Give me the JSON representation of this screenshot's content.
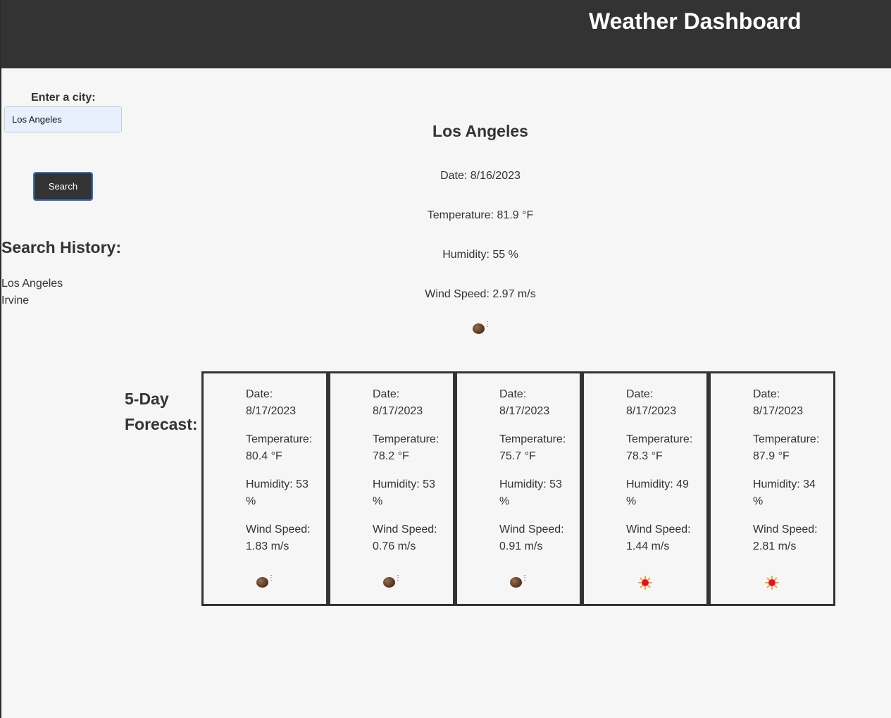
{
  "header": {
    "title": "Weather Dashboard"
  },
  "search": {
    "label": "Enter a city:",
    "value": "Los Angeles",
    "button_label": "Search"
  },
  "history": {
    "title": "Search History:",
    "items": [
      "Los Angeles",
      "Irvine"
    ]
  },
  "current": {
    "city": "Los Angeles",
    "date": "Date: 8/16/2023",
    "temperature": "Temperature: 81.9 °F",
    "humidity": "Humidity: 55 %",
    "wind": "Wind Speed: 2.97 m/s",
    "icon": "new-moon-face-icon"
  },
  "forecast": {
    "title_line1": "5-Day",
    "title_line2": "Forecast:",
    "days": [
      {
        "date_label": "Date:",
        "date": "8/17/2023",
        "temp_label": "Temperature:",
        "temp": "80.4 °F",
        "hum_label": "Humidity: 53",
        "hum_unit": "%",
        "wind_label": "Wind Speed:",
        "wind": "1.83 m/s",
        "icon": "new-moon-face-icon"
      },
      {
        "date_label": "Date:",
        "date": "8/17/2023",
        "temp_label": "Temperature:",
        "temp": "78.2 °F",
        "hum_label": "Humidity: 53",
        "hum_unit": "%",
        "wind_label": "Wind Speed:",
        "wind": "0.76 m/s",
        "icon": "new-moon-face-icon"
      },
      {
        "date_label": "Date:",
        "date": "8/17/2023",
        "temp_label": "Temperature:",
        "temp": "75.7 °F",
        "hum_label": "Humidity: 53",
        "hum_unit": "%",
        "wind_label": "Wind Speed:",
        "wind": "0.91 m/s",
        "icon": "new-moon-face-icon"
      },
      {
        "date_label": "Date:",
        "date": "8/17/2023",
        "temp_label": "Temperature:",
        "temp": "78.3 °F",
        "hum_label": "Humidity: 49",
        "hum_unit": "%",
        "wind_label": "Wind Speed:",
        "wind": "1.44 m/s",
        "icon": "sun-icon"
      },
      {
        "date_label": "Date:",
        "date": "8/17/2023",
        "temp_label": "Temperature:",
        "temp": "87.9 °F",
        "hum_label": "Humidity: 34",
        "hum_unit": "%",
        "wind_label": "Wind Speed:",
        "wind": "2.81 m/s",
        "icon": "sun-icon"
      }
    ]
  },
  "colors": {
    "header_bg": "#333333",
    "page_bg": "#f6f6f6",
    "input_bg": "#e8f0fe",
    "button_border": "#3a6fc4"
  }
}
